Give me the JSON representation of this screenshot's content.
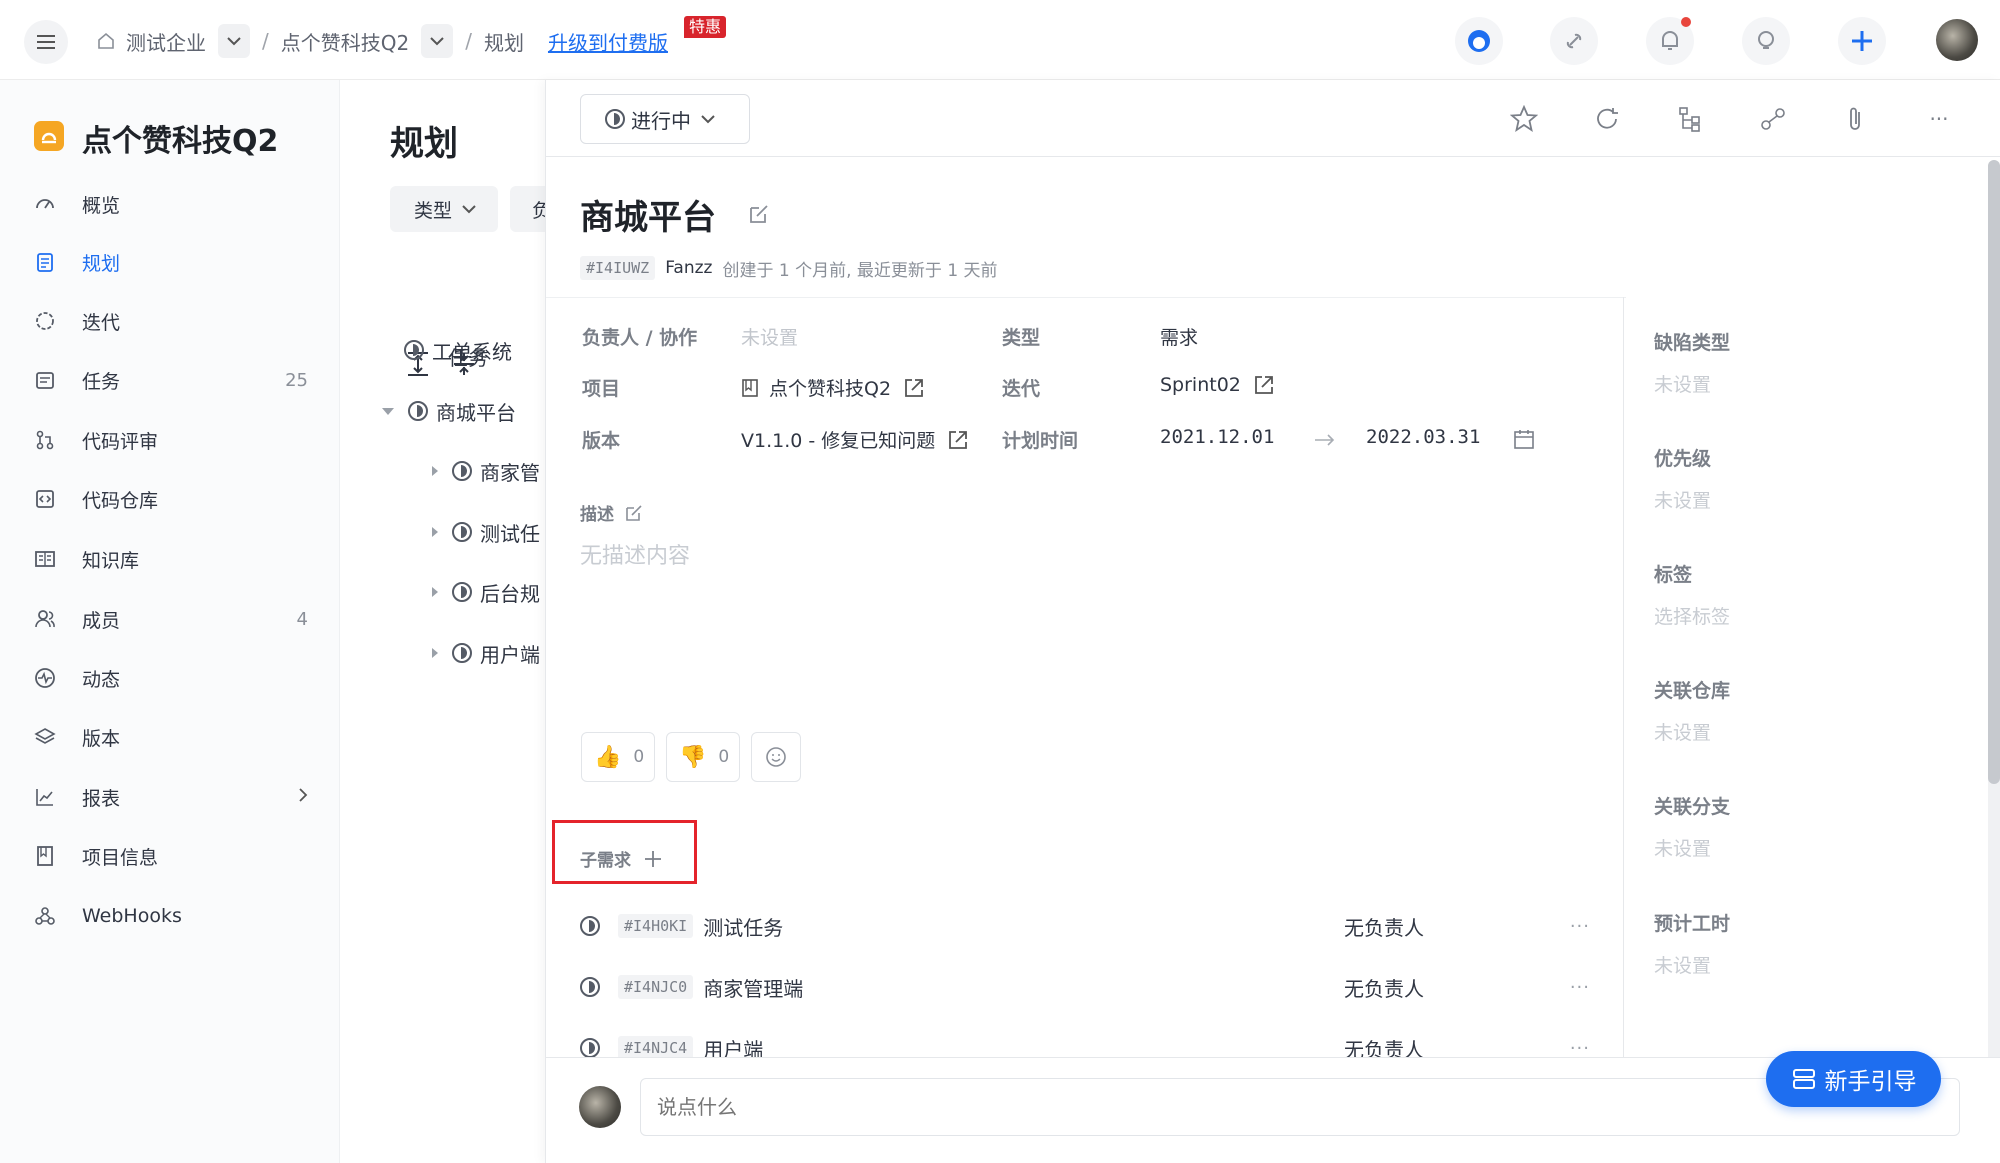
{
  "breadcrumb": {
    "org": "测试企业",
    "project": "点个赞科技Q2",
    "page": "规划",
    "upgrade": "升级到付费版",
    "hot_badge": "特惠"
  },
  "sidebar": {
    "project_name": "点个赞科技Q2",
    "items": [
      {
        "label": "概览",
        "icon": "dashboard-icon",
        "count": ""
      },
      {
        "label": "规划",
        "icon": "plan-icon",
        "count": ""
      },
      {
        "label": "迭代",
        "icon": "iteration-icon",
        "count": ""
      },
      {
        "label": "任务",
        "icon": "task-icon",
        "count": "25"
      },
      {
        "label": "代码评审",
        "icon": "pull-request-icon",
        "count": ""
      },
      {
        "label": "代码仓库",
        "icon": "code-repo-icon",
        "count": ""
      },
      {
        "label": "知识库",
        "icon": "book-icon",
        "count": ""
      },
      {
        "label": "成员",
        "icon": "members-icon",
        "count": "4"
      },
      {
        "label": "动态",
        "icon": "activity-icon",
        "count": ""
      },
      {
        "label": "版本",
        "icon": "layers-icon",
        "count": ""
      },
      {
        "label": "报表",
        "icon": "chart-icon",
        "count": ""
      },
      {
        "label": "项目信息",
        "icon": "project-info-icon",
        "count": ""
      },
      {
        "label": "WebHooks",
        "icon": "webhook-icon",
        "count": ""
      }
    ],
    "active": "规划"
  },
  "middle": {
    "title": "规划",
    "filter_type": "类型",
    "filter_owner": "负",
    "column_header": "任务",
    "tree": [
      {
        "label": "工单系统",
        "level": 0,
        "expand": "none"
      },
      {
        "label": "商城平台",
        "level": 0,
        "expand": "open"
      },
      {
        "label": "商家管",
        "level": 1,
        "expand": "closed"
      },
      {
        "label": "测试任",
        "level": 1,
        "expand": "closed"
      },
      {
        "label": "后台规",
        "level": 1,
        "expand": "closed"
      },
      {
        "label": "用户端",
        "level": 1,
        "expand": "closed"
      }
    ]
  },
  "detail": {
    "status": "进行中",
    "title": "商城平台",
    "id": "#I4IUWZ",
    "author": "Fanzz",
    "meta": "创建于 1 个月前, 最近更新于 1 天前",
    "fields": {
      "assignee_label": "负责人 / 协作",
      "assignee_value": "未设置",
      "type_label": "类型",
      "type_value": "需求",
      "project_label": "项目",
      "project_value": "点个赞科技Q2",
      "iteration_label": "迭代",
      "iteration_value": "Sprint02",
      "version_label": "版本",
      "version_value": "V1.1.0 - 修复已知问题",
      "plan_time_label": "计划时间",
      "plan_start": "2021.12.01",
      "plan_end": "2022.03.31"
    },
    "desc_label": "描述",
    "desc_empty": "无描述内容",
    "reactions": {
      "thumbs_up": "0",
      "thumbs_down": "0"
    },
    "sub_label": "子需求",
    "sub_items": [
      {
        "id": "#I4H0KI",
        "title": "测试任务",
        "assignee": "无负责人"
      },
      {
        "id": "#I4NJC0",
        "title": "商家管理端",
        "assignee": "无负责人"
      },
      {
        "id": "#I4NJC4",
        "title": "用户端",
        "assignee": "无负责人"
      }
    ],
    "right": [
      {
        "label": "缺陷类型",
        "value": "未设置"
      },
      {
        "label": "优先级",
        "value": "未设置"
      },
      {
        "label": "标签",
        "value": "选择标签"
      },
      {
        "label": "关联仓库",
        "value": "未设置"
      },
      {
        "label": "关联分支",
        "value": "未设置"
      },
      {
        "label": "预计工时",
        "value": "未设置"
      }
    ],
    "comment_placeholder": "说点什么"
  },
  "guide_button": "新手引导",
  "colors": {
    "accent": "#1e6ef0",
    "highlight": "#e4232b",
    "hot": "#d8242c"
  }
}
